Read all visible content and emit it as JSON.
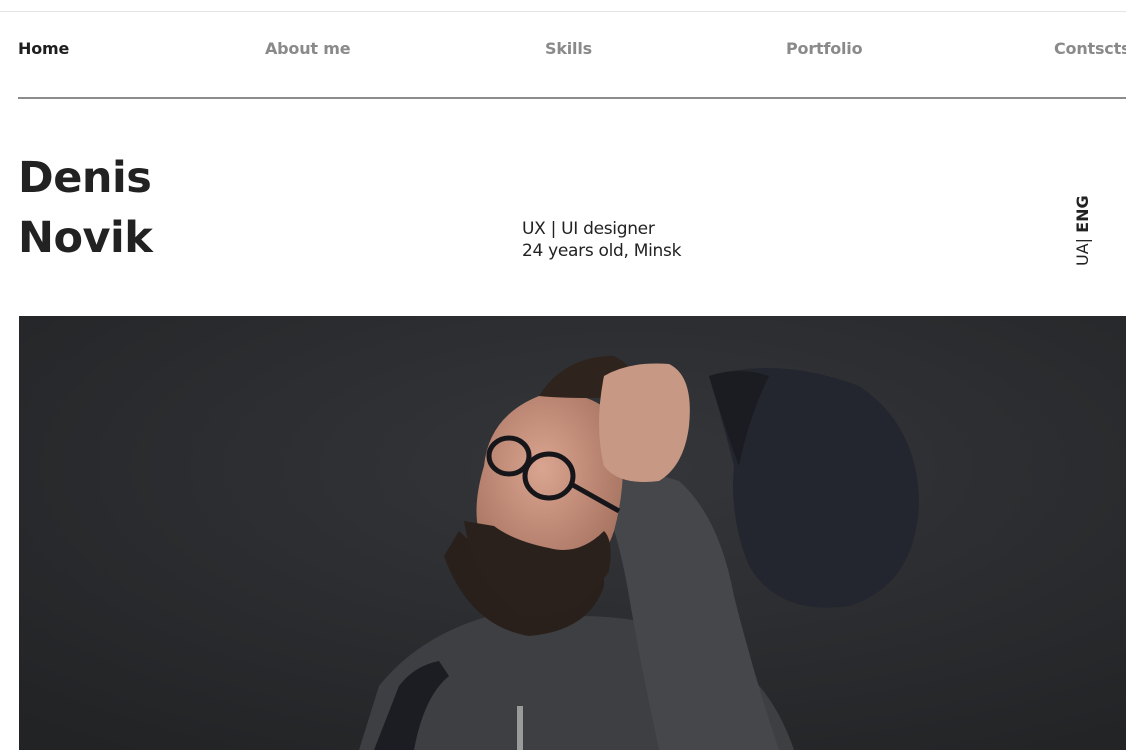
{
  "nav": {
    "items": [
      {
        "label": "Home",
        "active": true
      },
      {
        "label": "About me",
        "active": false
      },
      {
        "label": "Skills",
        "active": false
      },
      {
        "label": "Portfolio",
        "active": false
      },
      {
        "label": "Contscts",
        "active": false
      }
    ]
  },
  "hero": {
    "first_name": "Denis",
    "last_name": "Novik",
    "role": "UX | UI designer",
    "details": "24 years old, Minsk"
  },
  "language": {
    "ua": "UA|",
    "eng": "ENG"
  },
  "colors": {
    "text": "#222222",
    "nav_inactive": "#8a8a8a",
    "photo_background": "#2b2c2d"
  }
}
